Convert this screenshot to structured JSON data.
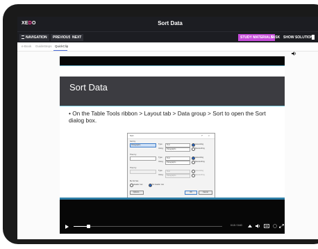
{
  "header": {
    "logo_main": "XE",
    "logo_accent": "D",
    "logo_suffix": "O",
    "title": "Sort Data"
  },
  "nav": {
    "navigation_label": "NAVIGATION",
    "previous_label": "PREVIOUS",
    "next_label": "NEXT",
    "study_materials_label": "STUDY MATERIALS",
    "task_label": "TASK",
    "show_solution_label": "SHOW SOLUTION",
    "accent_color": "#c44ad8"
  },
  "tabs": [
    {
      "label": "e-Book"
    },
    {
      "label": "GuideSteps"
    },
    {
      "label": "QuickClip"
    }
  ],
  "slide": {
    "title": "Sort Data",
    "bullet_prefix": "• On the ",
    "bullet_b1": "Table Tools",
    "bullet_t2": " ribbon > ",
    "bullet_b2": "Layout",
    "bullet_t3": " tab > ",
    "bullet_b3": "Data",
    "bullet_t4": " group > ",
    "bullet_b4": "Sort",
    "bullet_t5": " to open the Sort dialog box."
  },
  "dialog": {
    "title": "Sort",
    "help": "?",
    "close": "×",
    "sort_by_label": "Sort by",
    "sort_by_value": "Paragraphs",
    "type_label": "Type:",
    "type_value": "Text",
    "using_label": "Using:",
    "using_value": "Paragraphs",
    "ascending": "Ascending",
    "descending": "Descending",
    "then_by_1": "Then by",
    "then_by_2": "Then by",
    "my_list_has": "My list has",
    "header_row": "Header row",
    "no_header_row": "No header row",
    "options_btn": "Options...",
    "ok_btn": "OK",
    "cancel_btn": "Cancel"
  },
  "player": {
    "progress": 0.1,
    "time": "0:10 / 0:40"
  }
}
